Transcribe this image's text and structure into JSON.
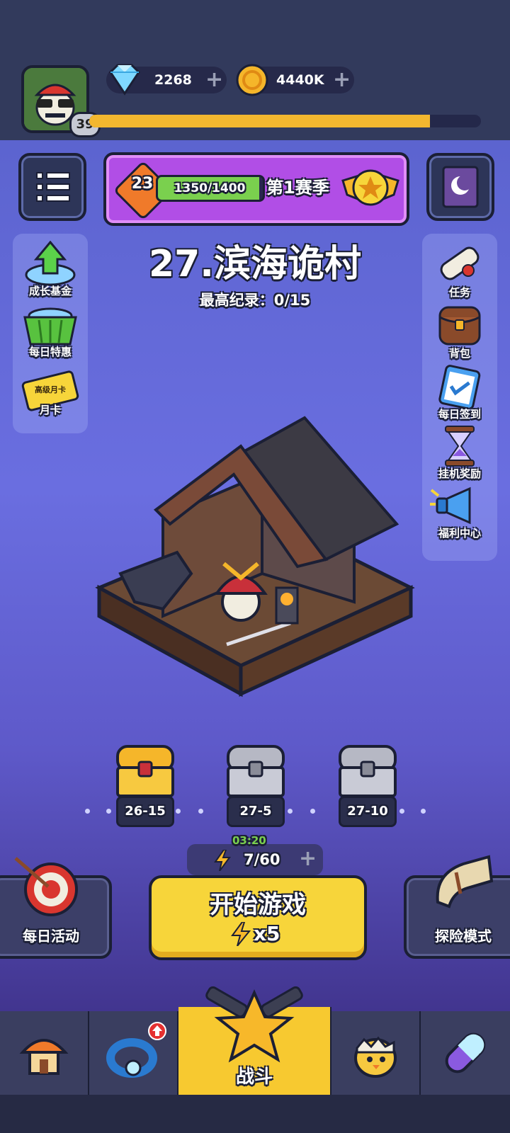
{
  "header": {
    "player_level": "39",
    "gems": "2268",
    "coins": "4440K",
    "xp_progress": 0.87
  },
  "season": {
    "level": "23",
    "progress_text": "1350/1400",
    "progress": 0.964,
    "name": "第1赛季"
  },
  "stage": {
    "title": "27.滨海诡村",
    "record": "最高纪录：0/15"
  },
  "left_menu": [
    {
      "label": "成长基金",
      "icon": "growth-fund-icon"
    },
    {
      "label": "每日特惠",
      "icon": "daily-deal-basket-icon"
    },
    {
      "label": "月卡",
      "icon": "monthly-card-icon",
      "card_text": "高级月卡"
    }
  ],
  "right_menu": [
    {
      "label": "任务",
      "icon": "quest-scroll-icon"
    },
    {
      "label": "背包",
      "icon": "backpack-icon"
    },
    {
      "label": "每日签到",
      "icon": "checkin-clipboard-icon"
    },
    {
      "label": "挂机奖励",
      "icon": "hourglass-icon"
    },
    {
      "label": "福利中心",
      "icon": "megaphone-icon"
    }
  ],
  "chests": [
    {
      "label": "26-15",
      "type": "gold"
    },
    {
      "label": "27-5",
      "type": "silver"
    },
    {
      "label": "27-10",
      "type": "silver"
    }
  ],
  "energy": {
    "timer": "03:20",
    "value": "7/60"
  },
  "actions": {
    "start_label": "开始游戏",
    "start_cost": "x5",
    "daily_activity": "每日活动",
    "adventure_mode": "探险模式"
  },
  "nav": {
    "battle_label": "战斗"
  },
  "colors": {
    "accent_yellow": "#f7d53a",
    "season_purple": "#b14ee6",
    "background": "#6a6ee0"
  }
}
